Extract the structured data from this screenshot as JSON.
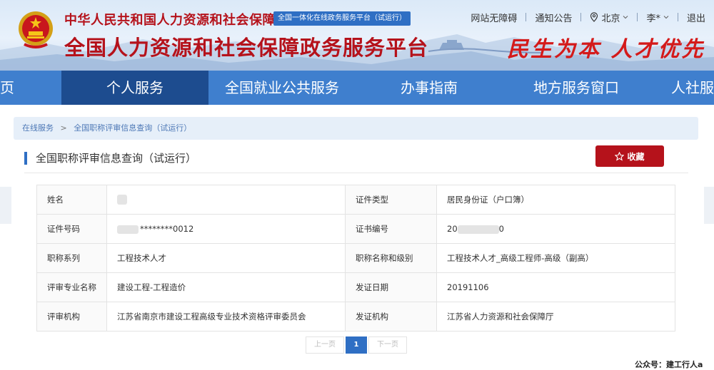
{
  "header": {
    "org_name": "中华人民共和国人力资源和社会保障部",
    "badge": "全国一体化在线政务服务平台（试运行）",
    "platform_title": "全国人力资源和社会保障政务服务平台",
    "slogan": "民生为本 人才优先",
    "links": {
      "accessibility": "网站无障碍",
      "notice": "通知公告",
      "city": "北京",
      "user": "李*",
      "logout": "退出"
    }
  },
  "nav": {
    "items": [
      "页",
      "个人服务",
      "全国就业公共服务",
      "办事指南",
      "地方服务窗口",
      "人社服务"
    ],
    "active_index": 1
  },
  "breadcrumb": {
    "root": "在线服务",
    "separator": ">",
    "current": "全国职称评审信息查询（试运行）"
  },
  "section": {
    "title": "全国职称评审信息查询（试运行）",
    "favorite_label": "收藏"
  },
  "info": {
    "name_label": "姓名",
    "name_value": "",
    "id_type_label": "证件类型",
    "id_type_value": "居民身份证（户口簿）",
    "id_no_label": "证件号码",
    "id_no_value": "********0012",
    "cert_no_label": "证书编号",
    "cert_no_prefix": "20",
    "cert_no_suffix": "0",
    "series_label": "职称系列",
    "series_value": "工程技术人才",
    "title_level_label": "职称名称和级别",
    "title_level_value": "工程技术人才_高级工程师-高级（副高）",
    "major_label": "评审专业名称",
    "major_value": "建设工程-工程造价",
    "issue_date_label": "发证日期",
    "issue_date_value": "20191106",
    "review_org_label": "评审机构",
    "review_org_value": "江苏省南京市建设工程高级专业技术资格评审委员会",
    "issuer_label": "发证机构",
    "issuer_value": "江苏省人力资源和社会保障厅"
  },
  "pager": {
    "prev": "上一页",
    "current": "1",
    "next": "下一页"
  },
  "watermark": "公众号：建工行人a",
  "colors": {
    "brand_red": "#b5121b",
    "nav_blue": "#3f7fce",
    "nav_active": "#1d4c8f",
    "accent_blue": "#2f6fc4"
  }
}
